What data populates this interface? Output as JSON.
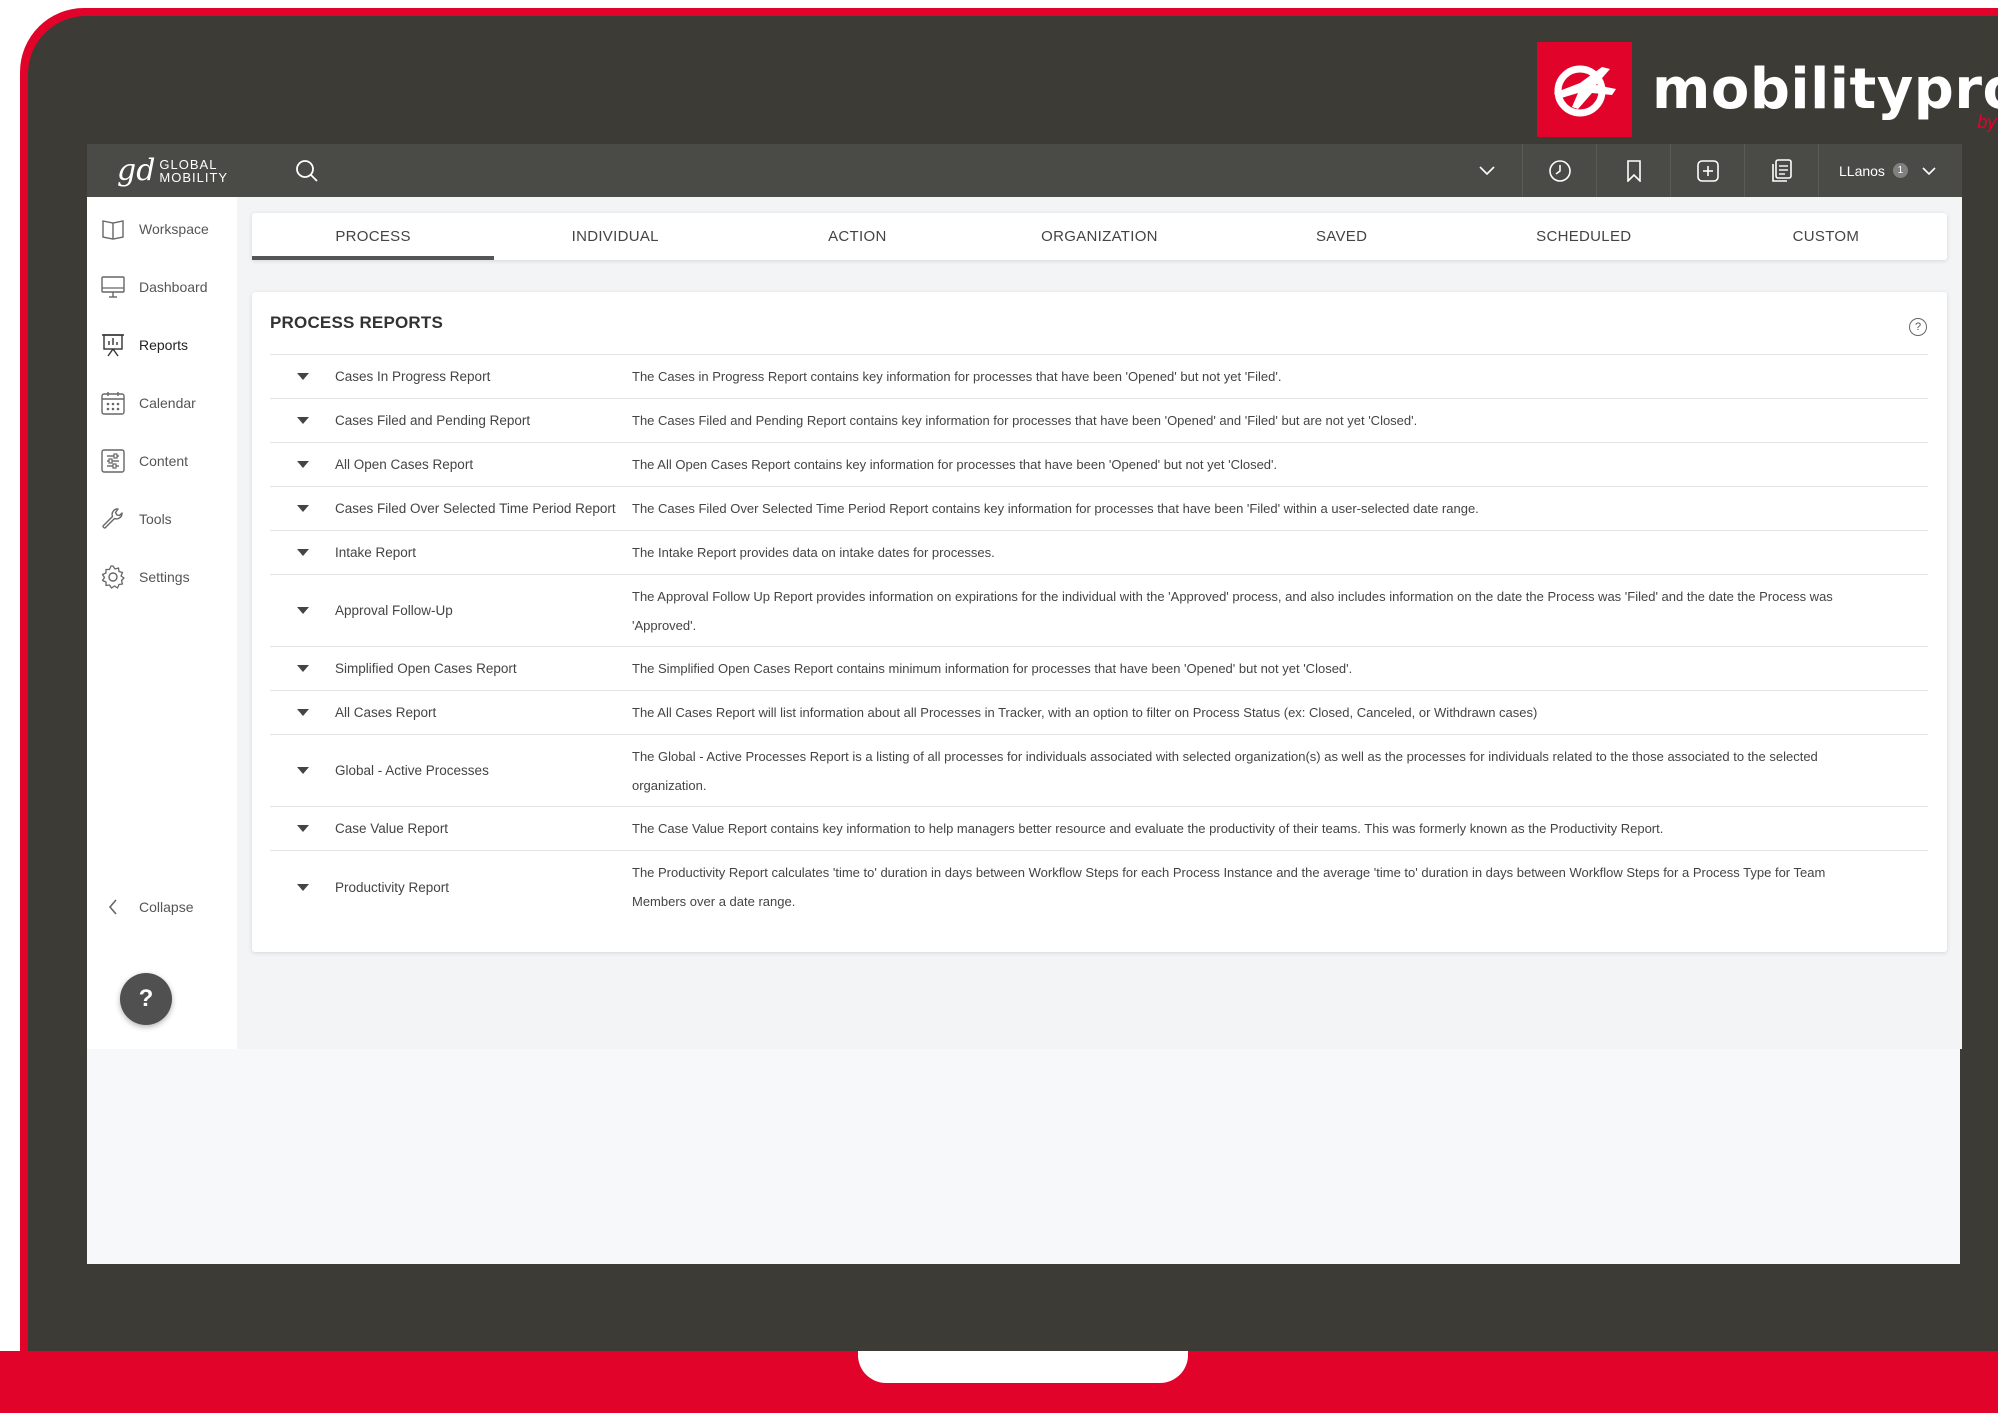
{
  "brand": {
    "logo_text": "mobilitypro",
    "logo_by": "by gd",
    "app_name": "GLOBAL MOBILITY",
    "app_monogram": "gd"
  },
  "topbar": {
    "icons": [
      "search-icon",
      "chevron-down-icon",
      "clock-history-icon",
      "bookmark-icon",
      "add-square-icon",
      "documents-icon"
    ],
    "user_name": "LLanos",
    "user_badge": "1"
  },
  "sidebar": {
    "items": [
      {
        "label": "Workspace",
        "icon": "book-icon"
      },
      {
        "label": "Dashboard",
        "icon": "monitor-icon"
      },
      {
        "label": "Reports",
        "icon": "presentation-chart-icon"
      },
      {
        "label": "Calendar",
        "icon": "calendar-icon"
      },
      {
        "label": "Content",
        "icon": "list-sliders-icon"
      },
      {
        "label": "Tools",
        "icon": "wrench-icon"
      },
      {
        "label": "Settings",
        "icon": "gear-icon"
      }
    ],
    "collapse_label": "Collapse",
    "help_label": "?"
  },
  "tabs": [
    "PROCESS",
    "INDIVIDUAL",
    "ACTION",
    "ORGANIZATION",
    "SAVED",
    "SCHEDULED",
    "CUSTOM"
  ],
  "panel": {
    "title": "PROCESS REPORTS",
    "help": "?",
    "reports": [
      {
        "name": "Cases In Progress Report",
        "desc": "The Cases in Progress Report contains key information for processes that have been 'Opened' but not yet 'Filed'."
      },
      {
        "name": "Cases Filed and Pending Report",
        "desc": "The Cases Filed and Pending Report contains key information for processes that have been 'Opened' and 'Filed' but are not yet 'Closed'."
      },
      {
        "name": "All Open Cases Report",
        "desc": "The All Open Cases Report contains key information for processes that have been 'Opened' but not yet 'Closed'."
      },
      {
        "name": "Cases Filed Over Selected Time Period Report",
        "desc": "The Cases Filed Over Selected Time Period Report contains key information for processes that have been 'Filed' within a user-selected date range."
      },
      {
        "name": "Intake Report",
        "desc": "The Intake Report provides data on intake dates for processes."
      },
      {
        "name": "Approval Follow-Up",
        "desc": "The Approval Follow Up Report provides information on expirations for the individual with the 'Approved' process, and also includes information on the date the Process was 'Filed' and the date the Process was 'Approved'."
      },
      {
        "name": "Simplified Open Cases Report",
        "desc": "The Simplified Open Cases Report contains minimum information for processes that have been 'Opened' but not yet 'Closed'."
      },
      {
        "name": "All Cases Report",
        "desc": "The All Cases Report will list information about all Processes in Tracker, with an option to filter on Process Status (ex: Closed, Canceled, or Withdrawn cases)"
      },
      {
        "name": "Global - Active Processes",
        "desc": "The Global - Active Processes Report is a listing of all processes for individuals associated with selected organization(s) as well as the processes for individuals related to the those associated to the selected organization."
      },
      {
        "name": "Case Value Report",
        "desc": "The Case Value Report contains key information to help managers better resource and evaluate the productivity of their teams. This was formerly known as the Productivity Report."
      },
      {
        "name": "Productivity Report",
        "desc": "The Productivity Report calculates 'time to' duration in days between Workflow Steps for each Process Instance and the average 'time to' duration in days between Workflow Steps for a Process Type for Team Members over a date range."
      }
    ]
  },
  "colors": {
    "brand_red": "#e2032b",
    "frame_dark": "#3c3b36",
    "topbar": "#4a4a47"
  }
}
